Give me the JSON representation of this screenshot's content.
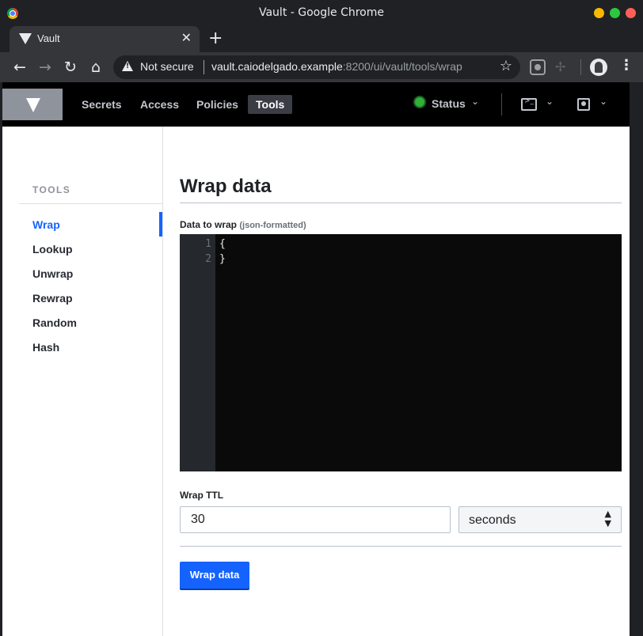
{
  "window": {
    "title": "Vault - Google Chrome"
  },
  "tab": {
    "title": "Vault",
    "close": "✕",
    "new_tab": "+"
  },
  "omnibox": {
    "security_label": "Not secure",
    "host": "vault.caiodelgado.example",
    "path": ":8200/ui/vault/tools/wrap"
  },
  "toolbar_icons": {
    "back": "←",
    "forward": "→",
    "reload": "↻",
    "home": "⌂",
    "star": "☆",
    "menu": "⋮"
  },
  "vault_nav": {
    "links": [
      "Secrets",
      "Access",
      "Policies",
      "Tools"
    ],
    "active": "Tools",
    "status_label": "Status",
    "status_color": "#2eb039",
    "chevron": "⌄"
  },
  "sidebar": {
    "heading": "TOOLS",
    "items": [
      "Wrap",
      "Lookup",
      "Unwrap",
      "Rewrap",
      "Random",
      "Hash"
    ],
    "active": "Wrap"
  },
  "main": {
    "title": "Wrap data",
    "data_label": "Data to wrap",
    "data_hint": "(json-formatted)",
    "editor_lines": [
      {
        "num": "1",
        "text": "{"
      },
      {
        "num": "2",
        "text": "}"
      }
    ],
    "ttl_label": "Wrap TTL",
    "ttl_value": "30",
    "ttl_unit": "seconds",
    "submit_label": "Wrap data"
  },
  "colors": {
    "accent": "#1563ff",
    "nav_bg": "#000000",
    "editor_bg": "#0a0a0a"
  }
}
